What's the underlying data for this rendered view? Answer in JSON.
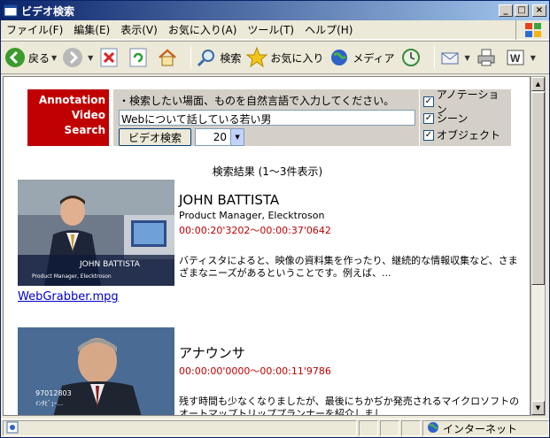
{
  "window": {
    "title": "ビデオ検索"
  },
  "menubar": {
    "items": [
      "ファイル(F)",
      "編集(E)",
      "表示(V)",
      "お気に入り(A)",
      "ツール(T)",
      "ヘルプ(H)"
    ]
  },
  "toolbar": {
    "back_label": "戻る",
    "search_label": "検索",
    "favorites_label": "お気に入り",
    "media_label": "メディア"
  },
  "logo": {
    "line1": "Annotation",
    "line2": "Video",
    "line3": "Search"
  },
  "search": {
    "instruction": "・検索したい場面、ものを自然言語で入力してください。",
    "query": "Webについて話している若い男",
    "button_label": "ビデオ検索",
    "count_value": "20"
  },
  "options": {
    "annotation": "アノテーション",
    "scene": "シーン",
    "object": "オブジェクト"
  },
  "results_summary": "検索結果 (1〜3件表示)",
  "results": [
    {
      "title": "JOHN BATTISTA",
      "subtitle": "Product Manager, Elecktroson",
      "time": "00:00:20'3202〜00:00:37'0642",
      "desc": "バティスタによると、映像の資料集を作ったり、継続的な情報収集など、さまざまなニーズがあるということです。例えば、...",
      "file": "WebGrabber.mpg",
      "caption_name": "JOHN BATTISTA",
      "caption_role": "Product Manager, Elecktroson"
    },
    {
      "title": "アナウンサ",
      "time": "00:00:00'0000〜00:00:11'9786",
      "desc": "残す時間も少なくなりましたが、最後にちかぢか発売されるマイクロソフトのオートマップトリッププランナーを紹介しまし...",
      "caption_code": "97012803",
      "caption_sub": "ｲﾝﾀﾋﾞｭｰ..."
    }
  ],
  "status": {
    "zone": "インターネット"
  }
}
